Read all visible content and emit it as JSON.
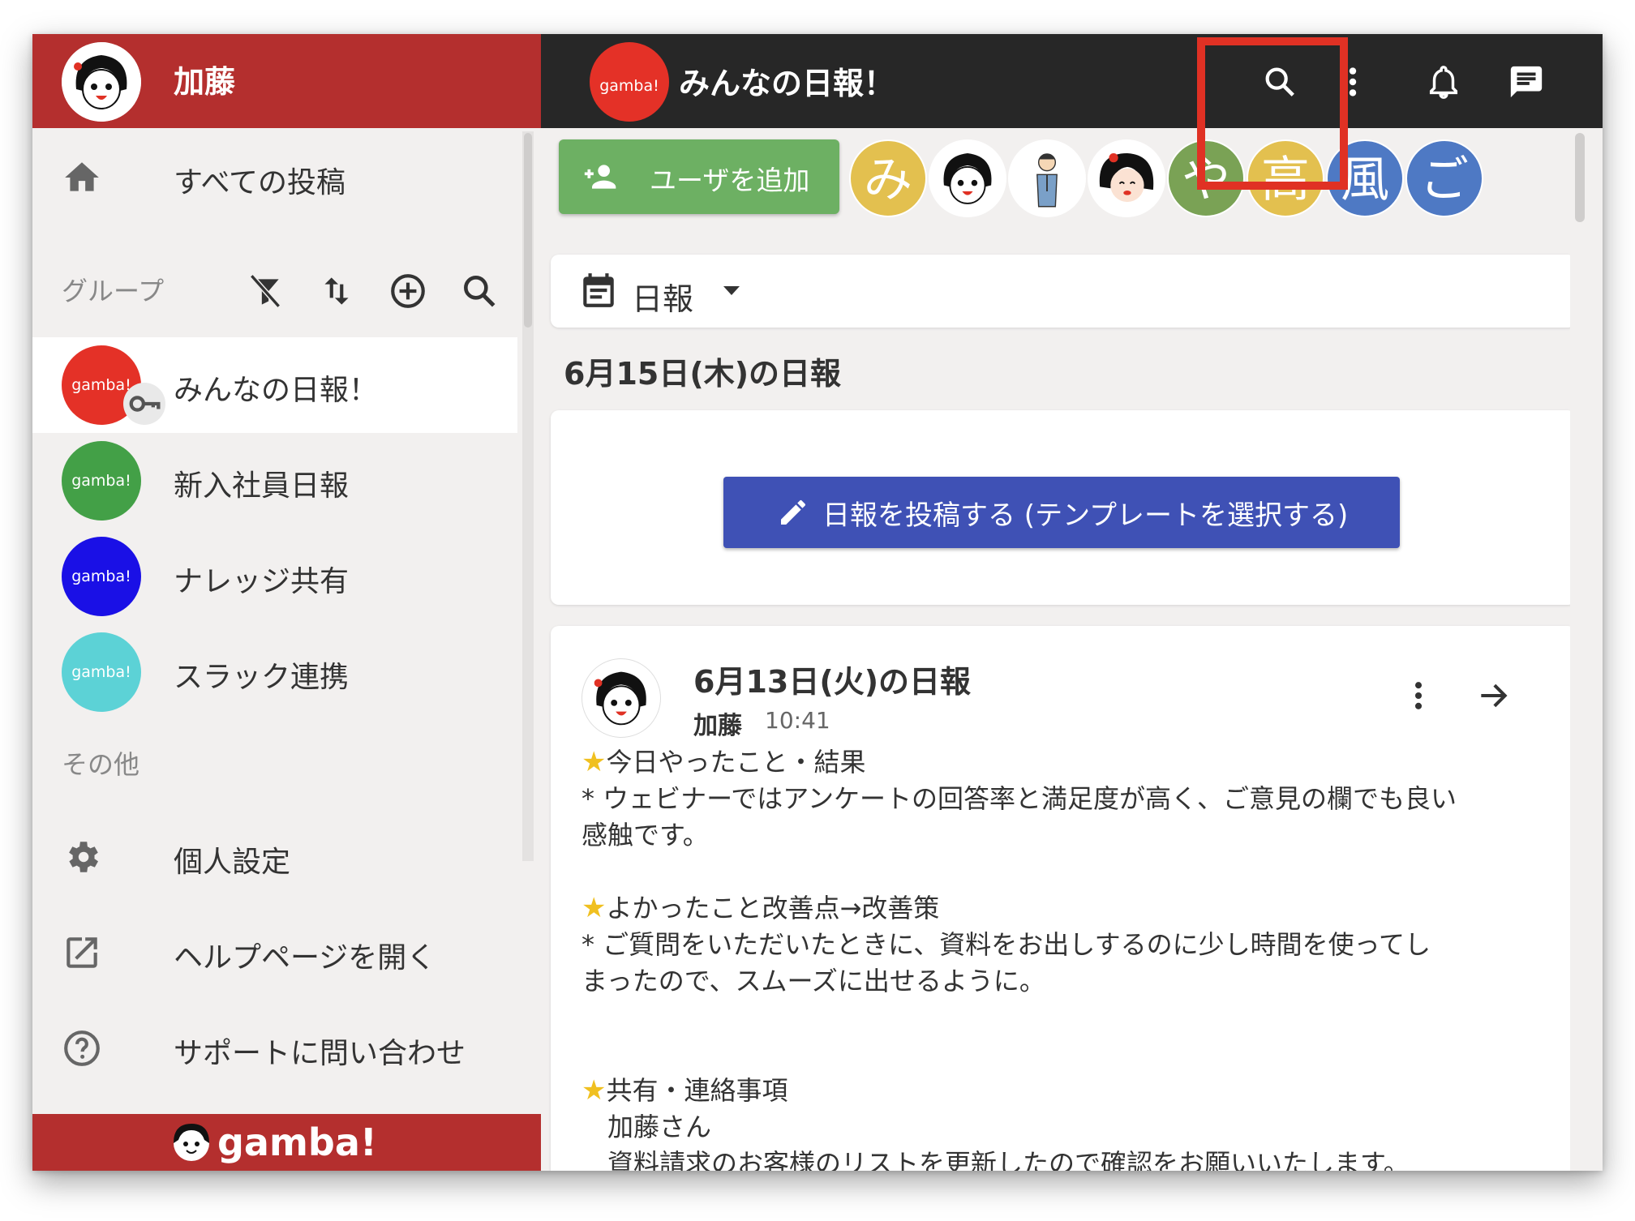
{
  "colors": {
    "sidebar_header": "#b42f2e",
    "topbar": "#272727",
    "add_user": "#6db063",
    "post_button": "#3f51b5",
    "highlight": "#e03124",
    "group_everyone": "#e43127",
    "group_newcomers": "#43a047",
    "group_knowledge": "#1a10e6",
    "group_slack": "#5cd2d6"
  },
  "sidebar": {
    "user_name": "加藤",
    "all_posts_label": "すべての投稿",
    "groups_label": "グループ",
    "groups": [
      {
        "name": "みんなの日報！",
        "logo_text": "gamba!"
      },
      {
        "name": "新入社員日報",
        "logo_text": "gamba!"
      },
      {
        "name": "ナレッジ共有",
        "logo_text": "gamba!"
      },
      {
        "name": "スラック連携",
        "logo_text": "gamba!"
      }
    ],
    "other_label": "その他",
    "other_items": [
      {
        "label": "個人設定",
        "icon": "gear-icon"
      },
      {
        "label": "ヘルプページを開く",
        "icon": "open-external-icon"
      },
      {
        "label": "サポートに問い合わせ",
        "icon": "help-circle-icon"
      }
    ],
    "footer_brand": "gamba!"
  },
  "topbar": {
    "logo_text": "gamba!",
    "title": "みんなの日報！"
  },
  "members_bar": {
    "add_user_label": "ユーザを追加",
    "members": [
      {
        "initial": "み",
        "color": "#e3c04f"
      },
      {
        "initial": "",
        "color": "#ffffff"
      },
      {
        "initial": "",
        "color": "#ffffff"
      },
      {
        "initial": "",
        "color": "#ffffff"
      },
      {
        "initial": "や",
        "color": "#7aa255"
      },
      {
        "initial": "高",
        "color": "#e3c04f"
      },
      {
        "initial": "風",
        "color": "#4e79c4"
      },
      {
        "initial": "ご",
        "color": "#4e79c4"
      }
    ]
  },
  "filter": {
    "selected": "日報"
  },
  "today": {
    "heading": "6月15日(木)の日報",
    "post_button_label": "日報を投稿する (テンプレートを選択する)"
  },
  "post": {
    "title": "6月13日(火)の日報",
    "author": "加藤",
    "time": "10:41",
    "lines": [
      "今日やったこと・結果",
      "* ウェビナーではアンケートの回答率と満足度が高く、ご意見の欄でも良い",
      "感触です。",
      "",
      "よかったこと改善点→改善策",
      "* ご質問をいただいたときに、資料をお出しするのに少し時間を使ってし",
      "まったので、スムーズに出せるように。",
      "",
      "",
      "共有・連絡事項",
      "　加藤さん",
      "　資料請求のお客様のリストを更新したので確認をお願いいたします。"
    ]
  }
}
